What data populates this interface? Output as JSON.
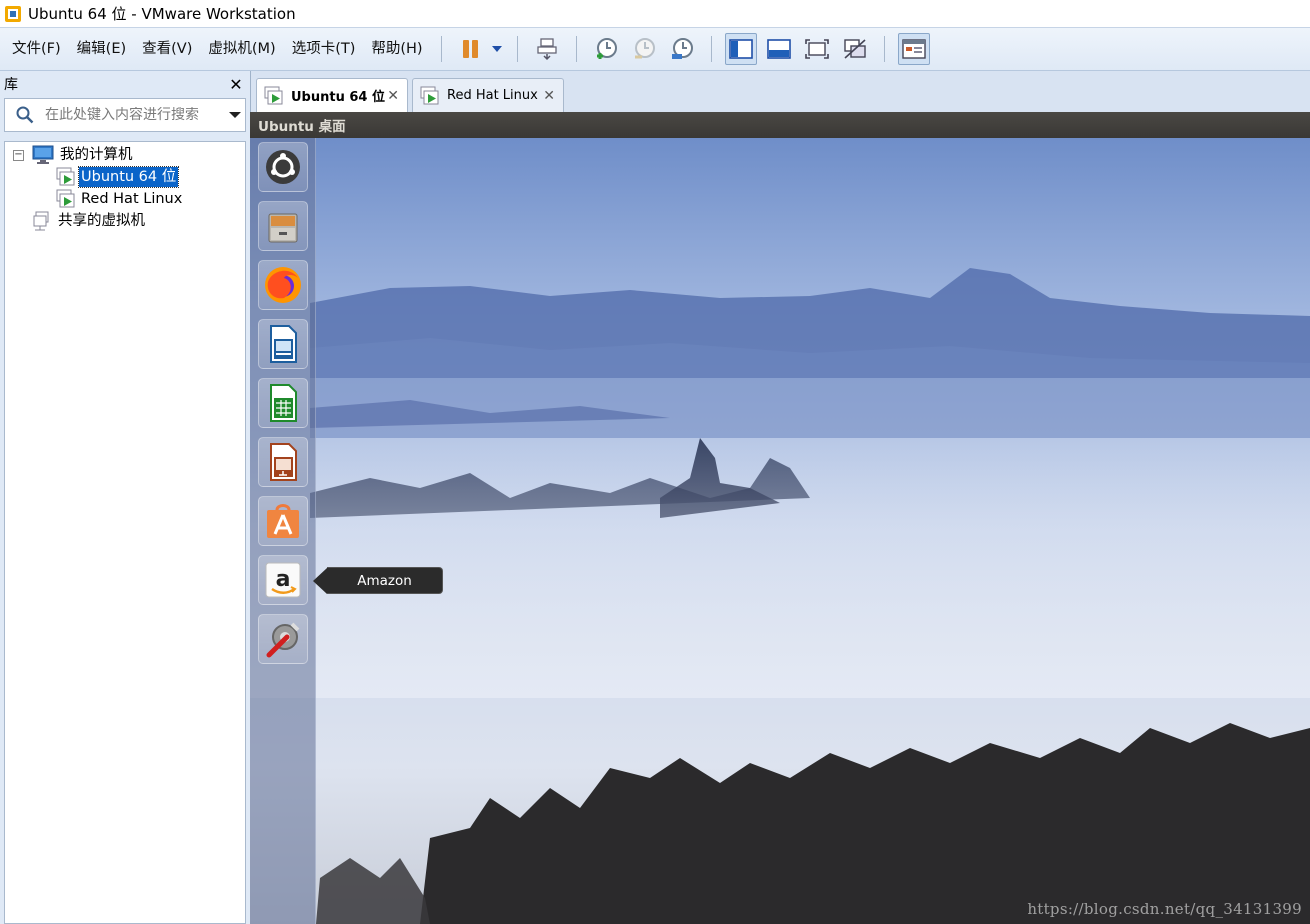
{
  "window": {
    "title": "Ubuntu 64 位 - VMware Workstation"
  },
  "menu": {
    "items": [
      "文件(F)",
      "编辑(E)",
      "查看(V)",
      "虚拟机(M)",
      "选项卡(T)",
      "帮助(H)"
    ]
  },
  "toolbar": {
    "buttons": [
      "pause-icon",
      "dropdown-arrow-icon",
      "send-ctrl-alt-del-icon",
      "snapshot-take-icon",
      "snapshot-revert-icon",
      "snapshot-manager-icon",
      "library-view-icon",
      "console-view-icon",
      "fullscreen-icon",
      "unity-icon",
      "thumbnail-view-icon"
    ],
    "active_buttons": [
      "library-view-icon",
      "thumbnail-view-icon"
    ]
  },
  "library": {
    "title": "库",
    "close_label": "✕",
    "search_placeholder": "在此处键入内容进行搜索",
    "tree": {
      "root_label": "我的计算机",
      "root_expander": "−",
      "vms": [
        {
          "label": "Ubuntu 64 位",
          "selected": true
        },
        {
          "label": "Red Hat Linux",
          "selected": false
        }
      ],
      "shared_label": "共享的虚拟机"
    }
  },
  "tabs": [
    {
      "label": "Ubuntu 64 位",
      "close": "✕",
      "active": true
    },
    {
      "label": "Red Hat Linux",
      "close": "✕",
      "active": false
    }
  ],
  "vm": {
    "topbar_title": "Ubuntu 桌面",
    "launcher_items": [
      "ubuntu-dash-icon",
      "files-icon",
      "firefox-icon",
      "libreoffice-writer-icon",
      "libreoffice-calc-icon",
      "libreoffice-impress-icon",
      "software-center-icon",
      "amazon-icon",
      "system-settings-icon"
    ],
    "tooltip": "Amazon",
    "watermark": "https://blog.csdn.net/qq_34131399"
  },
  "colors": {
    "selection": "#0a64c9",
    "menubar": "#dfe9f6",
    "launcher": "#6070a0"
  }
}
